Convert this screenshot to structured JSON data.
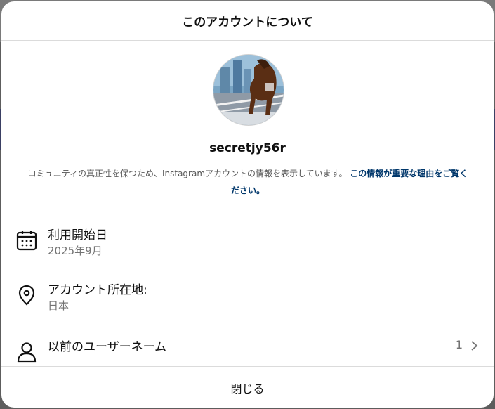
{
  "modal": {
    "title": "このアカウントについて",
    "username": "secretjy56r",
    "description": "コミュニティの真正性を保つため、Instagramアカウントの情報を表示しています。",
    "description_link": "この情報が重要な理由をご覧ください。",
    "rows": [
      {
        "icon": "calendar-icon",
        "label": "利用開始日",
        "value": "2025年9月"
      },
      {
        "icon": "location-pin-icon",
        "label": "アカウント所在地:",
        "value": "日本"
      },
      {
        "icon": "person-icon",
        "label": "以前のユーザーネーム",
        "count": "1"
      }
    ],
    "close_label": "閉じる"
  },
  "colors": {
    "link": "#00376b",
    "muted": "#737373",
    "divider": "#dbdbdb"
  }
}
